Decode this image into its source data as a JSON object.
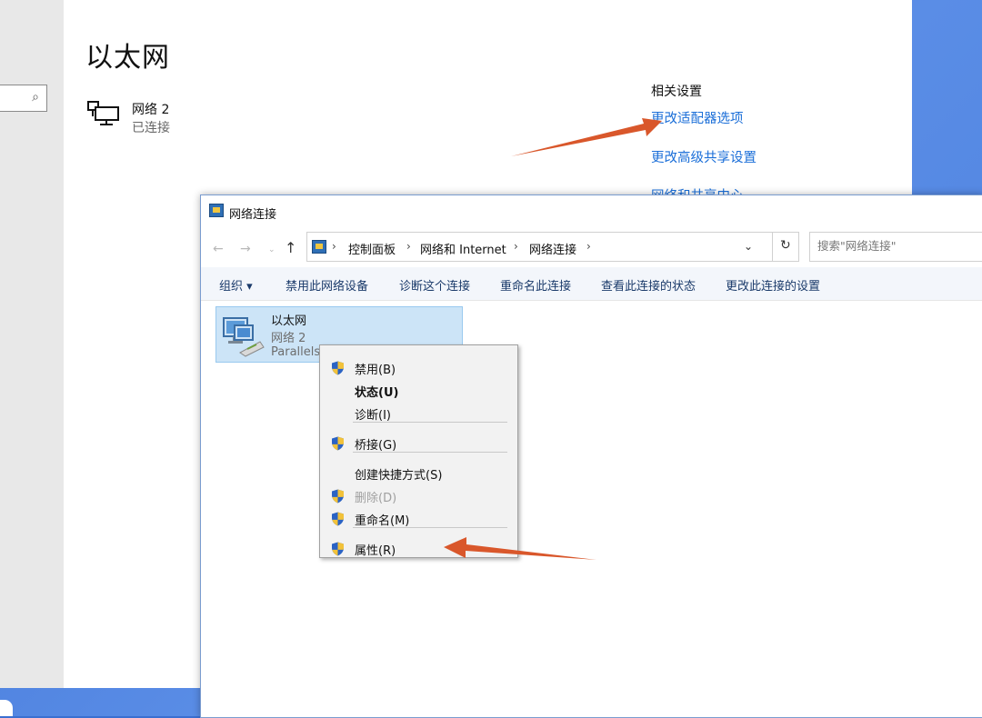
{
  "settings": {
    "page_title": "以太网",
    "network": {
      "name": "网络 2",
      "status": "已连接"
    },
    "related": {
      "title": "相关设置",
      "links": [
        "更改适配器选项",
        "更改高级共享设置",
        "网络和共享中心"
      ]
    }
  },
  "window": {
    "title": "网络连接",
    "nav": {
      "back": "←",
      "forward": "→",
      "dropdown": "⌄",
      "up": "↑"
    },
    "breadcrumb": [
      "控制面板",
      "网络和 Internet",
      "网络连接"
    ],
    "search_placeholder": "搜索\"网络连接\"",
    "commands": [
      "组织 ▾",
      "禁用此网络设备",
      "诊断这个连接",
      "重命名此连接",
      "查看此连接的状态",
      "更改此连接的设置"
    ],
    "adapter": {
      "name": "以太网",
      "network": "网络 2",
      "device": "Parallels"
    }
  },
  "context_menu": {
    "items": [
      {
        "label": "禁用(B)",
        "shield": true,
        "bold": false,
        "disabled": false
      },
      {
        "label": "状态(U)",
        "shield": false,
        "bold": true,
        "disabled": false
      },
      {
        "label": "诊断(I)",
        "shield": false,
        "bold": false,
        "disabled": false
      },
      {
        "label": "桥接(G)",
        "shield": true,
        "bold": false,
        "disabled": false
      },
      {
        "label": "创建快捷方式(S)",
        "shield": false,
        "bold": false,
        "disabled": false
      },
      {
        "label": "删除(D)",
        "shield": true,
        "bold": false,
        "disabled": true
      },
      {
        "label": "重命名(M)",
        "shield": true,
        "bold": false,
        "disabled": false
      },
      {
        "label": "属性(R)",
        "shield": true,
        "bold": false,
        "disabled": false
      }
    ]
  },
  "colors": {
    "link": "#1a6ed8",
    "arrow": "#d9572b",
    "selection": "#cce4f7"
  }
}
